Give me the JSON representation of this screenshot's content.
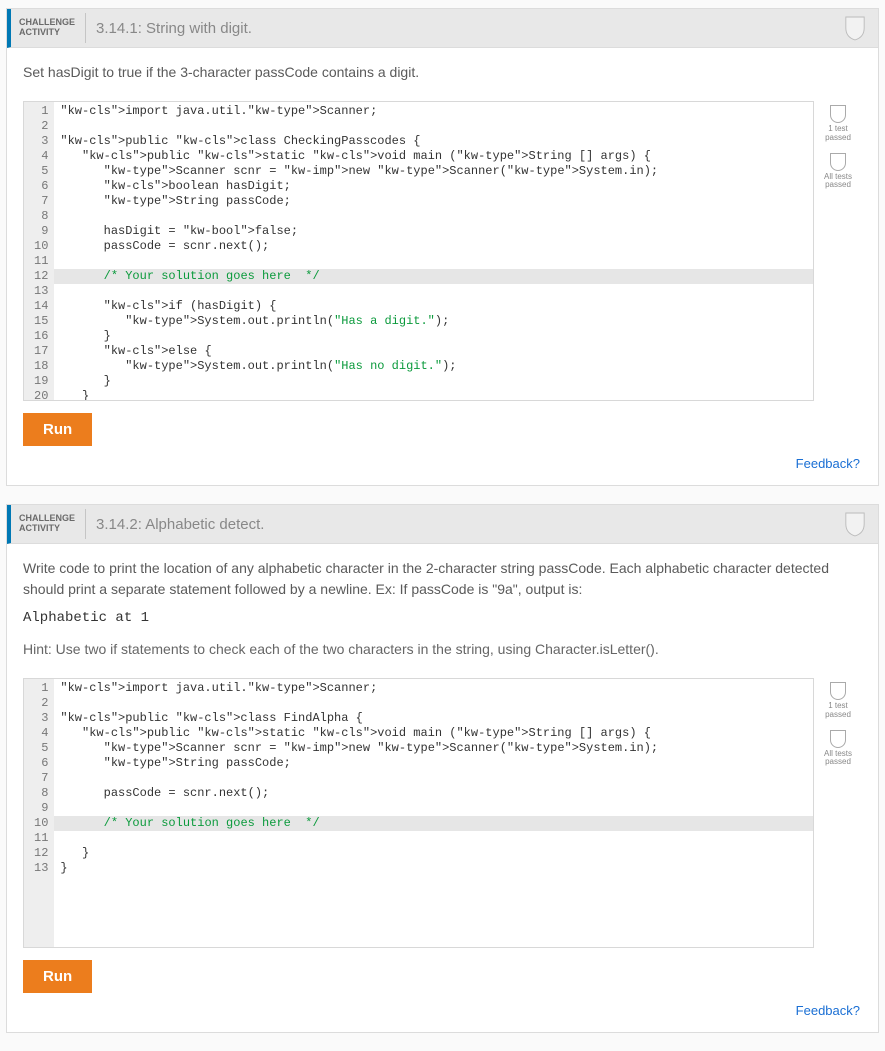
{
  "challenges": [
    {
      "label_line1": "CHALLENGE",
      "label_line2": "ACTIVITY",
      "title": "3.14.1: String with digit.",
      "description": "Set hasDigit to true if the 3-character passCode contains a digit.",
      "run_label": "Run",
      "feedback_label": "Feedback?",
      "badges": {
        "b1": "1 test\npassed",
        "b2": "All tests\npassed"
      },
      "code_lines": [
        "import java.util.Scanner;",
        "",
        "public class CheckingPasscodes {",
        "   public static void main (String [] args) {",
        "      Scanner scnr = new Scanner(System.in);",
        "      boolean hasDigit;",
        "      String passCode;",
        "",
        "      hasDigit = false;",
        "      passCode = scnr.next();",
        "",
        "      /* Your solution goes here  */",
        "",
        "      if (hasDigit) {",
        "         System.out.println(\"Has a digit.\");",
        "      }",
        "      else {",
        "         System.out.println(\"Has no digit.\");",
        "      }",
        "   }",
        "}"
      ],
      "highlight_line": 12
    },
    {
      "label_line1": "CHALLENGE",
      "label_line2": "ACTIVITY",
      "title": "3.14.2: Alphabetic detect.",
      "description": "Write code to print the location of any alphabetic character in the 2-character string passCode. Each alphabetic character detected should print a separate statement followed by a newline. Ex: If passCode is \"9a\", output is:",
      "sample_output": "Alphabetic at 1",
      "hint": "Hint: Use two if statements to check each of the two characters in the string, using Character.isLetter().",
      "run_label": "Run",
      "feedback_label": "Feedback?",
      "badges": {
        "b1": "1 test\npassed",
        "b2": "All tests\npassed"
      },
      "code_lines": [
        "import java.util.Scanner;",
        "",
        "public class FindAlpha {",
        "   public static void main (String [] args) {",
        "      Scanner scnr = new Scanner(System.in);",
        "      String passCode;",
        "",
        "      passCode = scnr.next();",
        "",
        "      /* Your solution goes here  */",
        "",
        "   }",
        "}"
      ],
      "highlight_line": 10
    }
  ]
}
